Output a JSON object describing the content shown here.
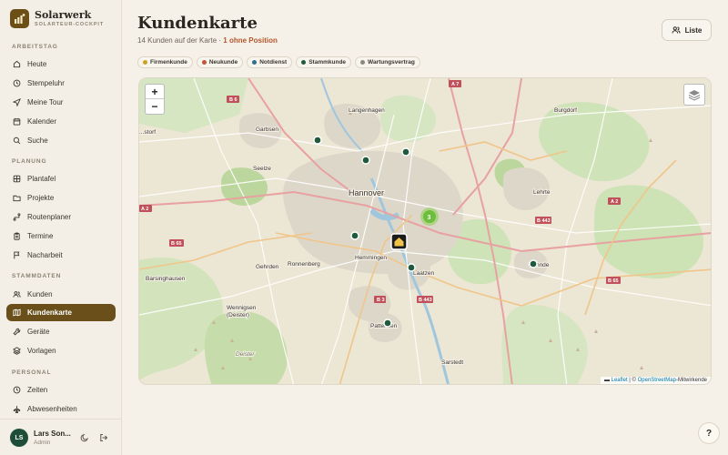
{
  "brand": {
    "title": "Solarwerk",
    "subtitle": "SOLARTEUR-COCKPIT"
  },
  "sidebar": {
    "sections": [
      {
        "label": "ARBEITSTAG",
        "items": [
          {
            "label": "Heute",
            "icon": "home-icon"
          },
          {
            "label": "Stempeluhr",
            "icon": "clock-icon"
          },
          {
            "label": "Meine Tour",
            "icon": "navigation-icon"
          },
          {
            "label": "Kalender",
            "icon": "calendar-icon"
          },
          {
            "label": "Suche",
            "icon": "search-icon"
          }
        ]
      },
      {
        "label": "PLANUNG",
        "items": [
          {
            "label": "Plantafel",
            "icon": "grid-icon"
          },
          {
            "label": "Projekte",
            "icon": "folder-icon"
          },
          {
            "label": "Routenplaner",
            "icon": "route-icon"
          },
          {
            "label": "Termine",
            "icon": "clipboard-icon"
          },
          {
            "label": "Nacharbeit",
            "icon": "flag-icon"
          }
        ]
      },
      {
        "label": "STAMMDATEN",
        "items": [
          {
            "label": "Kunden",
            "icon": "users-icon"
          },
          {
            "label": "Kundenkarte",
            "icon": "map-icon",
            "active": true
          },
          {
            "label": "Geräte",
            "icon": "wrench-icon"
          },
          {
            "label": "Vorlagen",
            "icon": "layers-icon"
          }
        ]
      },
      {
        "label": "PERSONAL",
        "items": [
          {
            "label": "Zeiten",
            "icon": "clock-icon"
          },
          {
            "label": "Abwesenheiten",
            "icon": "plane-icon"
          }
        ]
      }
    ]
  },
  "user": {
    "initials": "LS",
    "name": "Lars Son...",
    "role": "Admin"
  },
  "header": {
    "title": "Kundenkarte",
    "subtitle_prefix": "14 Kunden auf der Karte · ",
    "subtitle_warning": "1 ohne Position",
    "list_button": "Liste"
  },
  "legend": [
    {
      "label": "Firmenkunde",
      "color": "#c9a227"
    },
    {
      "label": "Neukunde",
      "color": "#c0553a"
    },
    {
      "label": "Notdienst",
      "color": "#2f6f8f"
    },
    {
      "label": "Stammkunde",
      "color": "#1f5a3d"
    },
    {
      "label": "Wartungsvertrag",
      "color": "#8a8a7a"
    }
  ],
  "map": {
    "zoom_in": "+",
    "zoom_out": "−",
    "cluster_count": "3",
    "attribution_link": "Leaflet",
    "attribution_text": " | © ",
    "attribution_osm": "OpenStreetMap",
    "attribution_suffix": "-Mitwirkende",
    "places": {
      "hannover": "Hannover",
      "langenhagen": "Langenhagen",
      "garbsen": "Garbsen",
      "seelze": "Seelze",
      "burgdorf": "Burgdorf",
      "lehrte": "Lehrte",
      "ronnenberg": "Ronnenberg",
      "hemmingen": "Hemmingen",
      "gehrden": "Gehrden",
      "laatzen": "Laatzen",
      "pattensen": "Pattensen",
      "sarstedt": "Sarstedt",
      "barsinghausen": "Barsinghausen",
      "wennigsen": "Wennigsen\n(Deister)",
      "sehnde": "Sehnde",
      "wunstorf": "...storf",
      "deister": "Deister"
    },
    "roads": {
      "a7": "A 7",
      "a2w": "A 2",
      "a2e": "A 2",
      "b6": "B 6",
      "b65a": "B 65",
      "b65b": "B 65",
      "b443": "B 443",
      "b443b": "B 443",
      "b3": "B 3"
    }
  },
  "help": "?"
}
